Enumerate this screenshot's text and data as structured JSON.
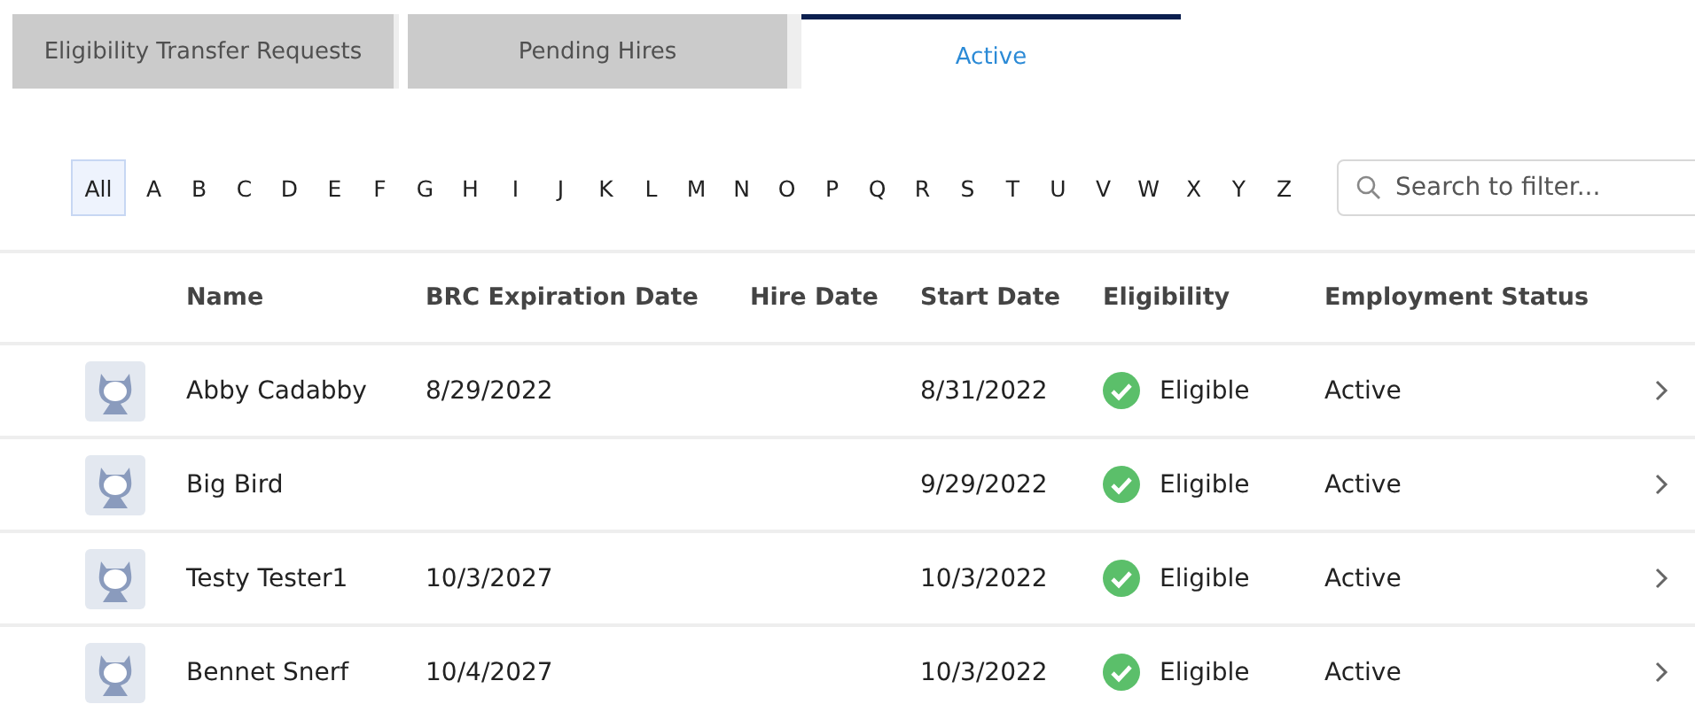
{
  "tabs": [
    {
      "label": "Eligibility Transfer Requests",
      "selected": false
    },
    {
      "label": "Pending Hires",
      "selected": false
    },
    {
      "label": "Active",
      "selected": true
    }
  ],
  "letters": [
    {
      "label": "All",
      "selected": true
    },
    {
      "label": "A",
      "selected": false
    },
    {
      "label": "B",
      "selected": false
    },
    {
      "label": "C",
      "selected": false
    },
    {
      "label": "D",
      "selected": false
    },
    {
      "label": "E",
      "selected": false
    },
    {
      "label": "F",
      "selected": false
    },
    {
      "label": "G",
      "selected": false
    },
    {
      "label": "H",
      "selected": false
    },
    {
      "label": "I",
      "selected": false
    },
    {
      "label": "J",
      "selected": false
    },
    {
      "label": "K",
      "selected": false
    },
    {
      "label": "L",
      "selected": false
    },
    {
      "label": "M",
      "selected": false
    },
    {
      "label": "N",
      "selected": false
    },
    {
      "label": "O",
      "selected": false
    },
    {
      "label": "P",
      "selected": false
    },
    {
      "label": "Q",
      "selected": false
    },
    {
      "label": "R",
      "selected": false
    },
    {
      "label": "S",
      "selected": false
    },
    {
      "label": "T",
      "selected": false
    },
    {
      "label": "U",
      "selected": false
    },
    {
      "label": "V",
      "selected": false
    },
    {
      "label": "W",
      "selected": false
    },
    {
      "label": "X",
      "selected": false
    },
    {
      "label": "Y",
      "selected": false
    },
    {
      "label": "Z",
      "selected": false
    }
  ],
  "search": {
    "placeholder": "Search to filter..."
  },
  "table": {
    "columns": [
      "Name",
      "BRC Expiration Date",
      "Hire Date",
      "Start Date",
      "Eligibility",
      "Employment Status"
    ],
    "rows": [
      {
        "name": "Abby Cadabby",
        "brc": "8/29/2022",
        "hire": "",
        "start": "8/31/2022",
        "eligibility": "Eligible",
        "eligible": true,
        "status": "Active"
      },
      {
        "name": "Big Bird",
        "brc": "",
        "hire": "",
        "start": "9/29/2022",
        "eligibility": "Eligible",
        "eligible": true,
        "status": "Active"
      },
      {
        "name": "Testy Tester1",
        "brc": "10/3/2027",
        "hire": "",
        "start": "10/3/2022",
        "eligibility": "Eligible",
        "eligible": true,
        "status": "Active"
      },
      {
        "name": "Bennet Snerf",
        "brc": "10/4/2027",
        "hire": "",
        "start": "10/3/2022",
        "eligibility": "Eligible",
        "eligible": true,
        "status": "Active"
      }
    ]
  }
}
